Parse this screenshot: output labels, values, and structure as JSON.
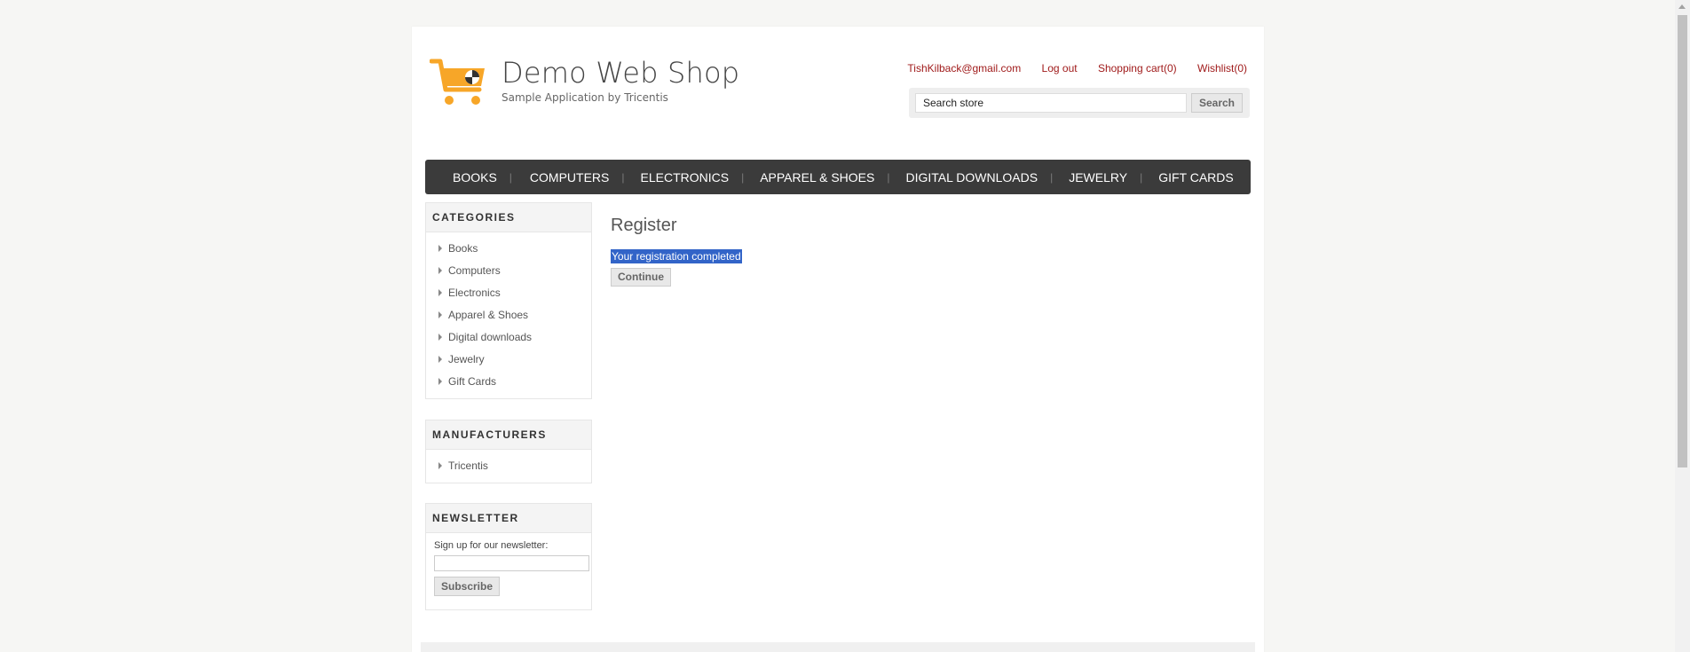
{
  "brand": {
    "title": "Demo Web Shop",
    "subtitle": "Sample Application by Tricentis",
    "logo_icon": "shopping-cart-icon",
    "logo_color": "#f7a628"
  },
  "header_links": {
    "account": "TishKilback@gmail.com",
    "logout": "Log out",
    "cart": "Shopping cart(0)",
    "wishlist": "Wishlist(0)",
    "link_color": "#a01b1b"
  },
  "search": {
    "value": "Search store",
    "button": "Search"
  },
  "top_menu": [
    {
      "label": "BOOKS"
    },
    {
      "label": "COMPUTERS"
    },
    {
      "label": "ELECTRONICS"
    },
    {
      "label": "APPAREL & SHOES"
    },
    {
      "label": "DIGITAL DOWNLOADS"
    },
    {
      "label": "JEWELRY"
    },
    {
      "label": "GIFT CARDS"
    }
  ],
  "categories": {
    "title": "CATEGORIES",
    "items": [
      "Books",
      "Computers",
      "Electronics",
      "Apparel & Shoes",
      "Digital downloads",
      "Jewelry",
      "Gift Cards"
    ]
  },
  "manufacturers": {
    "title": "MANUFACTURERS",
    "items": [
      "Tricentis"
    ]
  },
  "newsletter": {
    "title": "NEWSLETTER",
    "label": "Sign up for our newsletter:",
    "button": "Subscribe"
  },
  "main": {
    "title": "Register",
    "result": "Your registration completed",
    "continue_button": "Continue"
  }
}
